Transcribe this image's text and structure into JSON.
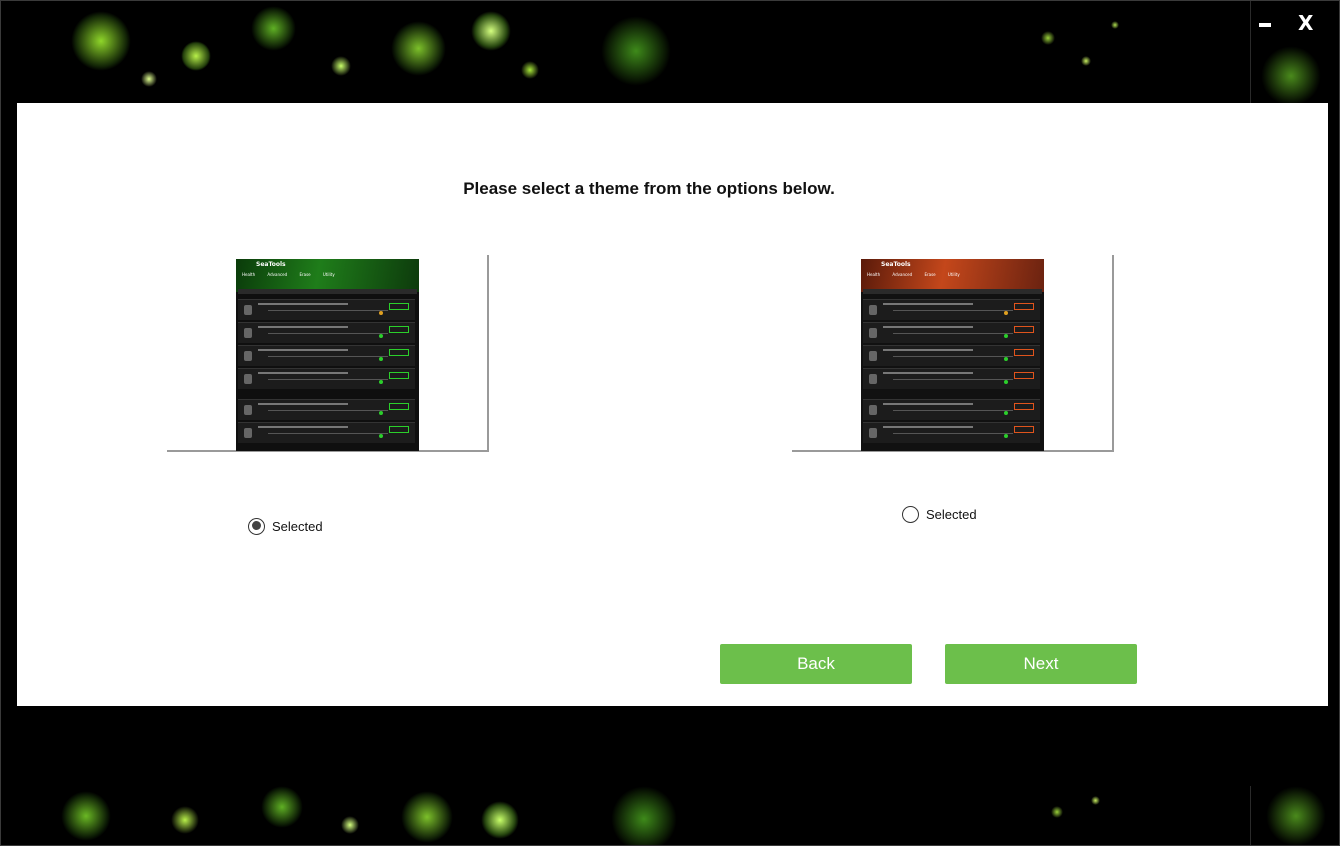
{
  "window": {
    "minimize_symbol": "",
    "close_symbol": "X"
  },
  "heading": "Please select a theme from the options below.",
  "themes": [
    {
      "id": "green",
      "preview": {
        "app_title": "SeaTools",
        "tabs": [
          "Health",
          "Advanced",
          "Erase",
          "Utility"
        ],
        "accent": "#2bcf2b"
      },
      "radio_label": "Selected",
      "checked": true
    },
    {
      "id": "orange",
      "preview": {
        "app_title": "SeaTools",
        "tabs": [
          "Health",
          "Advanced",
          "Erase",
          "Utility"
        ],
        "accent": "#e0541c"
      },
      "radio_label": "Selected",
      "checked": false
    }
  ],
  "buttons": {
    "back": "Back",
    "next": "Next"
  },
  "colors": {
    "button_green": "#6cbf4b",
    "background": "#000000",
    "panel": "#ffffff"
  }
}
